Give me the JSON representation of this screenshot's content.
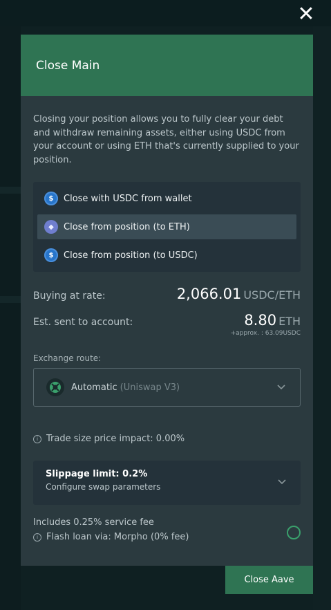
{
  "modal": {
    "title": "Close Main",
    "description": "Closing your position allows you to fully clear your debt and withdraw remaining assets, either using USDC from your account or using ETH that's currently supplied to your position.",
    "options": [
      {
        "label": "Close with USDC from wallet",
        "icon": "usdc-icon",
        "selected": false
      },
      {
        "label": "Close from position (to ETH)",
        "icon": "eth-icon",
        "selected": true
      },
      {
        "label": "Close from position (to USDC)",
        "icon": "usdc-icon",
        "selected": false
      }
    ],
    "buying_rate": {
      "label": "Buying at rate:",
      "value": "2,066.01",
      "unit": "USDC/ETH"
    },
    "sent": {
      "label": "Est. sent to account:",
      "value": "8.80",
      "unit": "ETH",
      "approx": "+approx. : 63.09USDC"
    },
    "route": {
      "label": "Exchange route:",
      "name": "Automatic",
      "sub": "(Uniswap V3)"
    },
    "impact": "Trade size price impact: 0.00%",
    "slippage": {
      "title": "Slippage limit: 0.2%",
      "sub": "Configure swap parameters"
    },
    "fee": "Includes 0.25% service fee",
    "flash": "Flash loan via: Morpho (0% fee)",
    "close_button": "Close Aave"
  },
  "colors": {
    "header": "#2f7453",
    "modal_bg": "#2b3a3f",
    "accent": "#3aa06c"
  }
}
